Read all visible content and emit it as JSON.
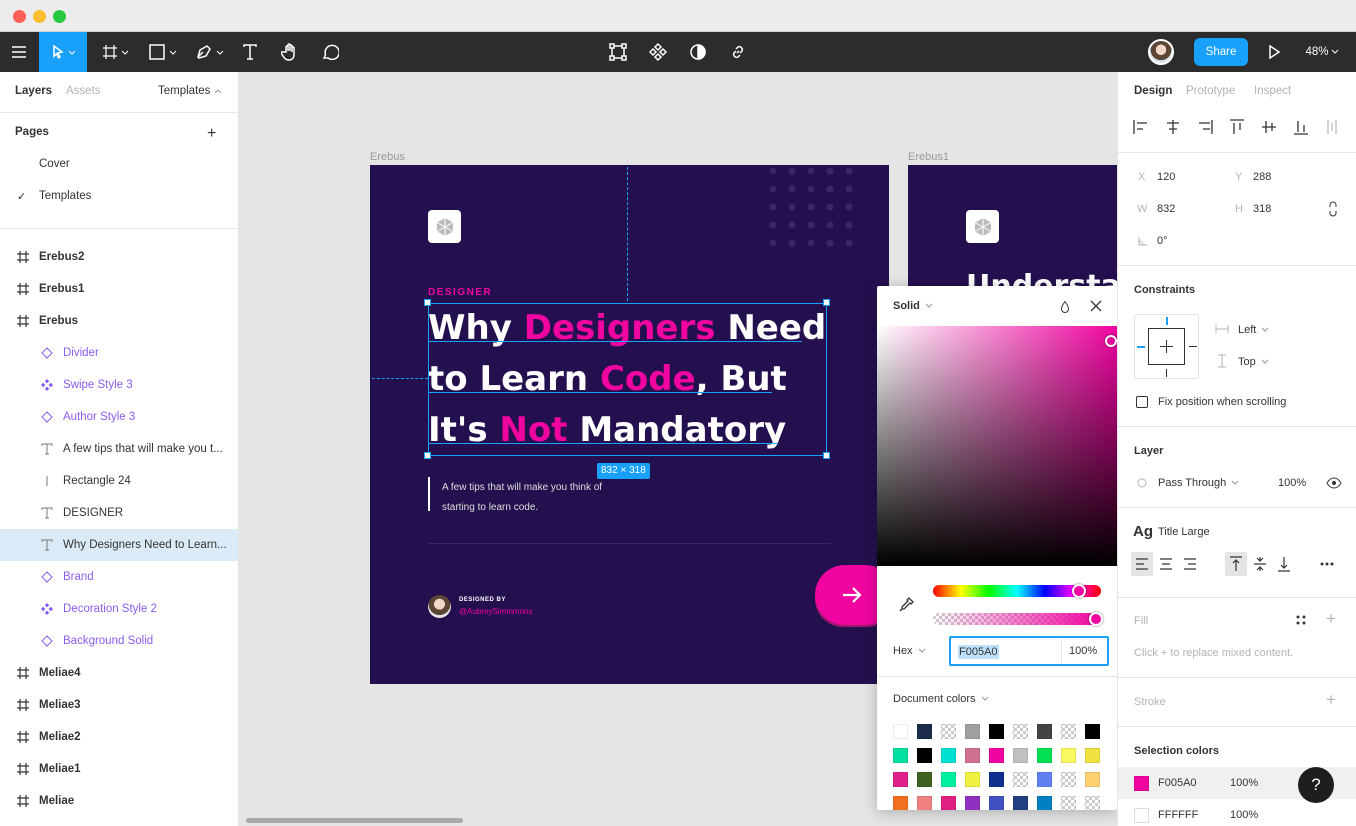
{
  "toolbar": {
    "share_label": "Share",
    "zoom": "48%"
  },
  "left_panel": {
    "tabs": {
      "layers": "Layers",
      "assets": "Assets",
      "templates": "Templates"
    },
    "pages_title": "Pages",
    "pages": [
      "Cover",
      "Templates"
    ],
    "layers": [
      {
        "label": "Erebus2",
        "type": "frame"
      },
      {
        "label": "Erebus1",
        "type": "frame"
      },
      {
        "label": "Erebus",
        "type": "frame"
      },
      {
        "label": "Divider",
        "type": "instance"
      },
      {
        "label": "Swipe Style 3",
        "type": "component"
      },
      {
        "label": "Author Style 3",
        "type": "instance"
      },
      {
        "label": "A few tips that will make you t...",
        "type": "text"
      },
      {
        "label": "Rectangle 24",
        "type": "line"
      },
      {
        "label": "DESIGNER",
        "type": "text"
      },
      {
        "label": "Why Designers Need to Learn...",
        "type": "text"
      },
      {
        "label": "Brand",
        "type": "instance"
      },
      {
        "label": "Decoration Style 2",
        "type": "component"
      },
      {
        "label": "Background Solid",
        "type": "instance"
      },
      {
        "label": "Meliae4",
        "type": "frame"
      },
      {
        "label": "Meliae3",
        "type": "frame"
      },
      {
        "label": "Meliae2",
        "type": "frame"
      },
      {
        "label": "Meliae1",
        "type": "frame"
      },
      {
        "label": "Meliae",
        "type": "frame"
      }
    ]
  },
  "canvas": {
    "frame1_title": "Erebus",
    "frame2_title": "Erebus1",
    "eyebrow": "DESIGNER",
    "headline": {
      "w1": "Why",
      "w2": "Designers",
      "w3": "Need",
      "w4": "to Learn",
      "w5": "Code",
      "w6": ", But",
      "w7": "It's",
      "w8": "Not",
      "w9": "Mandatory"
    },
    "dimension_badge": "832 × 318",
    "body_line1": "A few tips that will make you think of",
    "body_line2": "starting to learn code.",
    "designed_by": "DESIGNED BY",
    "author": "@AubreySimmmons",
    "frame2_partial_text": "Understand th"
  },
  "color_picker": {
    "mode": "Solid",
    "format": "Hex",
    "hex": "F005A0",
    "opacity": "100%",
    "document_colors": "Document colors",
    "swatches": [
      [
        "#ffffff",
        "#1c2b4a",
        "checker",
        "#a0a0a0",
        "#000000",
        "checker",
        "#444444",
        "checker",
        "#000000"
      ],
      [
        "#00e0a0",
        "#000000",
        "#00e0d0",
        "#d07090",
        "#f005a0",
        "#c0c0c0",
        "#00e050",
        "#f8f860",
        "#f0e040"
      ],
      [
        "#e0208c",
        "#406020",
        "#00f0a0",
        "#f0f040",
        "#103090",
        "checker",
        "#6080f0",
        "checker",
        "#ffd070"
      ],
      [
        "#f07020",
        "#f08080",
        "#e02080",
        "#9030c0",
        "#4050c0",
        "#204080",
        "#0080c0",
        "checker",
        "checker"
      ]
    ]
  },
  "right_panel": {
    "tabs": {
      "design": "Design",
      "prototype": "Prototype",
      "inspect": "Inspect"
    },
    "x_label": "X",
    "x": "120",
    "y_label": "Y",
    "y": "288",
    "w_label": "W",
    "w": "832",
    "h_label": "H",
    "h": "318",
    "rotation": "0°",
    "constraints_title": "Constraints",
    "constraint_h": "Left",
    "constraint_v": "Top",
    "fix_position": "Fix position when scrolling",
    "layer_title": "Layer",
    "blend": "Pass Through",
    "layer_opacity": "100%",
    "text_style_icon": "Ag",
    "text_style": "Title Large",
    "fill_title": "Fill",
    "fill_hint": "Click + to replace mixed content.",
    "stroke_title": "Stroke",
    "selection_colors_title": "Selection colors",
    "selection_colors": [
      {
        "hex": "F005A0",
        "opacity": "100%",
        "color": "#f005a0"
      },
      {
        "hex": "FFFFFF",
        "opacity": "100%",
        "color": "#ffffff"
      }
    ],
    "help": "?"
  },
  "colors": {
    "accent": "#18a0fb",
    "brand_pink": "#f005a0",
    "frame_bg": "#24104f",
    "toolbar_bg": "#2c2c2c"
  }
}
